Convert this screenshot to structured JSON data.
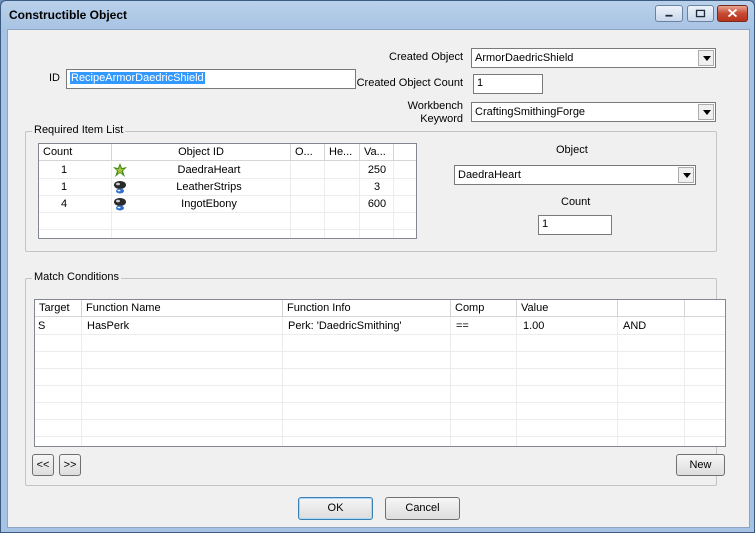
{
  "window": {
    "title": "Constructible Object"
  },
  "form": {
    "id_label": "ID",
    "id_value": "RecipeArmorDaedricShield",
    "created_object_label": "Created Object",
    "created_object_value": "ArmorDaedricShield",
    "created_object_count_label": "Created Object Count",
    "created_object_count_value": "1",
    "workbench_keyword_label_line1": "Workbench",
    "workbench_keyword_label_line2": "Keyword",
    "workbench_keyword_value": "CraftingSmithingForge"
  },
  "required_items": {
    "group_label": "Required Item List",
    "columns": [
      "Count",
      "Object ID",
      "O...",
      "He...",
      "Va..."
    ],
    "rows": [
      {
        "count": "1",
        "object_id": "DaedraHeart",
        "icon": "daedra-heart-icon",
        "value": "250"
      },
      {
        "count": "1",
        "object_id": "LeatherStrips",
        "icon": "leather-strips-icon",
        "value": "3"
      },
      {
        "count": "4",
        "object_id": "IngotEbony",
        "icon": "ingot-ebony-icon",
        "value": "600"
      }
    ],
    "object_label": "Object",
    "object_value": "DaedraHeart",
    "count_label": "Count",
    "count_value": "1"
  },
  "match_conditions": {
    "group_label": "Match Conditions",
    "columns": [
      "Target",
      "Function Name",
      "Function Info",
      "Comp",
      "Value",
      ""
    ],
    "rows": [
      {
        "target": "S",
        "function_name": "HasPerk",
        "function_info": "Perk: 'DaedricSmithing'",
        "comp": "==",
        "value": "1.00",
        "logic": "AND"
      }
    ],
    "prev_label": "<<",
    "next_label": ">>",
    "new_label": "New"
  },
  "buttons": {
    "ok": "OK",
    "cancel": "Cancel"
  },
  "colors": {
    "selection": "#3399ff",
    "title_gradient": "#a7c3e3",
    "close_button": "#c74a32"
  }
}
